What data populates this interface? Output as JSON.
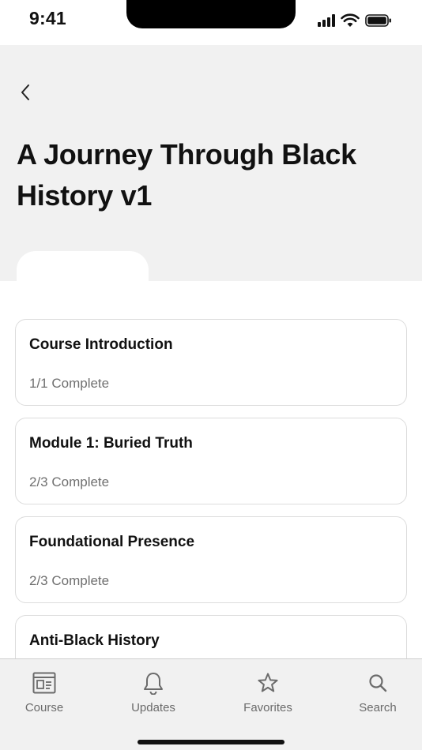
{
  "status_bar": {
    "time": "9:41"
  },
  "header": {
    "title": "A Journey Through Black History v1"
  },
  "modules": [
    {
      "title": "Course Introduction",
      "progress": "1/1 Complete"
    },
    {
      "title": "Module 1: Buried Truth",
      "progress": "2/3 Complete"
    },
    {
      "title": "Foundational Presence",
      "progress": "2/3 Complete"
    },
    {
      "title": "Anti-Black History",
      "progress": ""
    }
  ],
  "tab_bar": {
    "items": [
      {
        "label": "Course",
        "icon": "course-icon"
      },
      {
        "label": "Updates",
        "icon": "bell-icon"
      },
      {
        "label": "Favorites",
        "icon": "star-icon"
      },
      {
        "label": "Search",
        "icon": "search-icon"
      }
    ]
  },
  "colors": {
    "header_bg": "#f1f1f1",
    "card_border": "#dcdcdc",
    "secondary_text": "#707070",
    "tab_icon": "#6b6b6b"
  }
}
